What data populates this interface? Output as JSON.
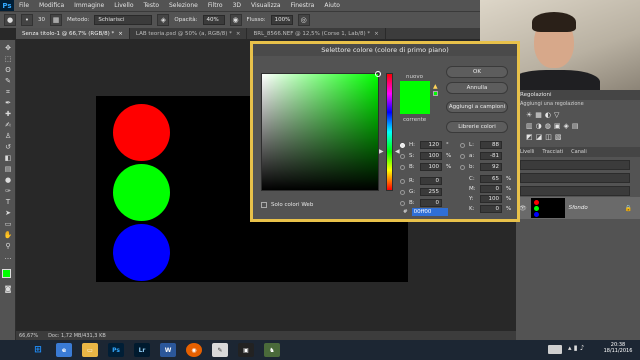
{
  "app": {
    "logo": "Ps"
  },
  "menu": [
    "File",
    "Modifica",
    "Immagine",
    "Livello",
    "Testo",
    "Selezione",
    "Filtro",
    "3D",
    "Visualizza",
    "Finestra",
    "Aiuto"
  ],
  "options_bar": {
    "size": "30",
    "mode_label": "Metodo:",
    "mode_value": "Schiarisci",
    "opacity_label": "Opacità:",
    "opacity_value": "40%",
    "flow_label": "Flusso:",
    "flow_value": "100%"
  },
  "tabs": [
    {
      "label": "Senza titolo-1 @ 66,7% (RGB/8) *",
      "active": true
    },
    {
      "label": "LAB teoria.psd @ 50% (a, RGB/8) *",
      "active": false
    },
    {
      "label": "BRL_8566.NEF @ 12,5% (Corse 1, Lab/8) *",
      "active": false
    }
  ],
  "canvas": {
    "circles": [
      {
        "name": "red-circle",
        "color": "#ff0000"
      },
      {
        "name": "green-circle",
        "color": "#00ff00"
      },
      {
        "name": "blue-circle",
        "color": "#0000ff"
      }
    ]
  },
  "status": {
    "zoom": "66,67%",
    "doc": "Doc: 1,72 MB/431,3 KB"
  },
  "dialog": {
    "title": "Selettore colore (colore di primo piano)",
    "new_label": "nuovo",
    "current_label": "corrente",
    "new_color": "#00ff00",
    "current_color": "#00ff00",
    "ok": "OK",
    "cancel": "Annulla",
    "add_swatch": "Aggiungi a campioni",
    "libraries": "Librerie colori",
    "web_only": "Solo colori Web",
    "hsb": [
      {
        "label": "H:",
        "value": "120",
        "unit": "°",
        "selected": true
      },
      {
        "label": "S:",
        "value": "100",
        "unit": "%",
        "selected": false
      },
      {
        "label": "B:",
        "value": "100",
        "unit": "%",
        "selected": false
      }
    ],
    "rgb": [
      {
        "label": "R:",
        "value": "0"
      },
      {
        "label": "G:",
        "value": "255"
      },
      {
        "label": "B:",
        "value": "0"
      }
    ],
    "lab": [
      {
        "label": "L:",
        "value": "88"
      },
      {
        "label": "a:",
        "value": "-81"
      },
      {
        "label": "b:",
        "value": "92"
      }
    ],
    "cmyk": [
      {
        "label": "C:",
        "value": "65",
        "unit": "%"
      },
      {
        "label": "M:",
        "value": "0",
        "unit": "%"
      },
      {
        "label": "Y:",
        "value": "100",
        "unit": "%"
      },
      {
        "label": "K:",
        "value": "0",
        "unit": "%"
      }
    ],
    "hex_label": "#",
    "hex": "00ff00"
  },
  "right_panel": {
    "adjust_header": "Regolazioni",
    "adjust_sub": "Aggiungi una regolazione",
    "layers_tabs": [
      "Livelli",
      "Tracciati",
      "Canali"
    ],
    "layer_name": "Sfondo"
  },
  "taskbar": {
    "icons": [
      "Ps",
      "Lr",
      "W"
    ],
    "time": "20:38",
    "date": "18/11/2016"
  }
}
